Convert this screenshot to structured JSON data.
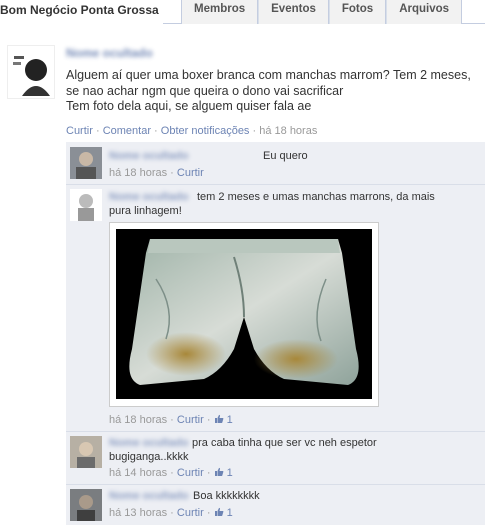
{
  "header": {
    "group_title": "Bom Negócio Ponta Grossa",
    "tabs": [
      "Membros",
      "Eventos",
      "Fotos",
      "Arquivos"
    ]
  },
  "post": {
    "author": "Nome ocultado",
    "text": "Alguem aí quer uma boxer branca com manchas marrom? Tem 2 meses,\nse nao achar ngm que queira o dono vai sacrificar\nTem foto dela aqui, se alguem quiser fala ae",
    "actions": {
      "like": "Curtir",
      "comment": "Comentar",
      "notify": "Obter notificações",
      "time": "há 18 horas"
    }
  },
  "comments": [
    {
      "name": "Nome ocultado",
      "text": "Eu quero",
      "time": "há 18 horas",
      "like": "Curtir",
      "likes": ""
    },
    {
      "name": "Nome ocultado",
      "text": "tem 2 meses e umas manchas marrons, da mais pura linhagem!",
      "time": "há 18 horas",
      "like": "Curtir",
      "likes": "1"
    },
    {
      "name": "Nome ocultado",
      "text": "pra caba tinha que ser vc neh espetor bugiganga..kkkk",
      "time": "há 14 horas",
      "like": "Curtir",
      "likes": "1"
    },
    {
      "name": "Nome ocultado",
      "text": "Boa kkkkkkkk",
      "time": "há 13 horas",
      "like": "Curtir",
      "likes": "1"
    }
  ],
  "colors": {
    "link": "#6d84b4",
    "name": "#3b5998",
    "comment_bg": "#edeff4",
    "meta": "#999999"
  },
  "icons": {
    "like": "thumbs-up-icon"
  }
}
